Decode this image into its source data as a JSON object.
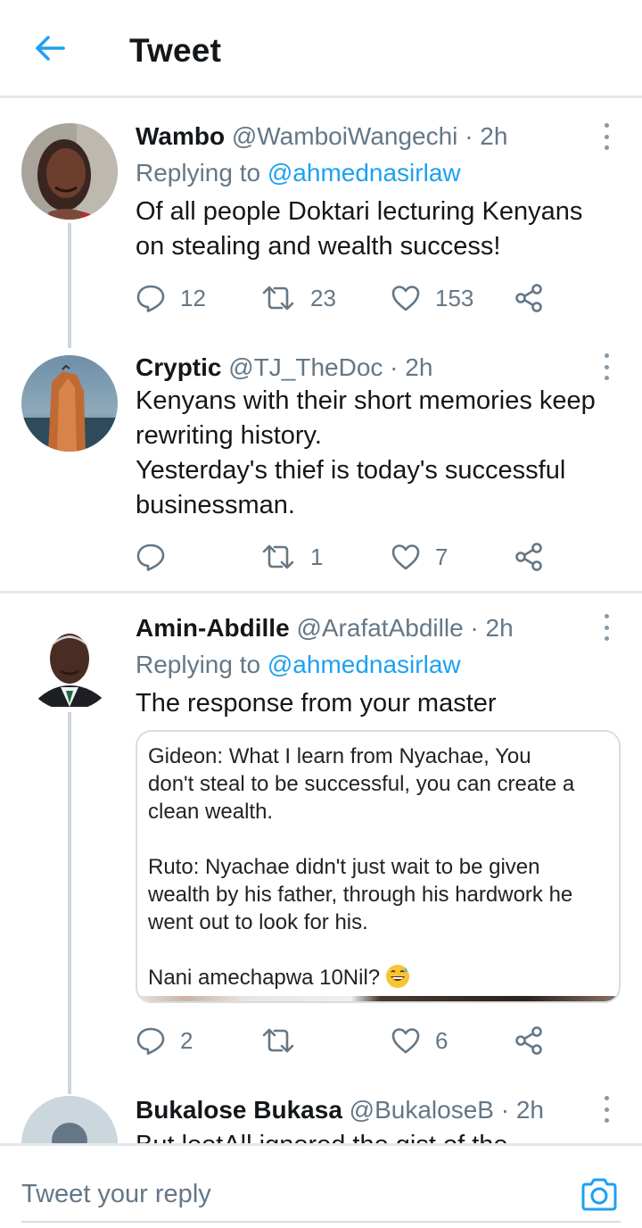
{
  "header": {
    "title": "Tweet",
    "back_icon": "arrow-left-icon"
  },
  "colors": {
    "accent": "#1da1f2",
    "secondary_text": "#657786",
    "divider": "#e3e8ec"
  },
  "tweets": [
    {
      "name": "Wambo",
      "handle": "@WamboiWangechi",
      "time": "· 2h",
      "replying_prefix": "Replying to",
      "replying_to": "@ahmednasirlaw",
      "text_lines": [
        "Of all people Doktari lecturing Kenyans",
        "on stealing and wealth success!"
      ],
      "replies": "12",
      "retweets": "23",
      "likes": "153"
    },
    {
      "name": "Cryptic",
      "handle": "@TJ_TheDoc",
      "time": "· 2h",
      "text_lines": [
        "Kenyans with their short memories keep",
        "rewriting history.",
        "Yesterday's thief is today's successful",
        "businessman."
      ],
      "replies": "",
      "retweets": "1",
      "likes": "7"
    },
    {
      "name": "Amin-Abdille",
      "handle": "@ArafatAbdille",
      "time": "· 2h",
      "replying_prefix": "Replying to",
      "replying_to": "@ahmednasirlaw",
      "text_lines": [
        "The response from your master"
      ],
      "image_text": {
        "para1": [
          "Gideon: What I learn from Nyachae,  You",
          "don't steal to be successful, you can create a",
          "clean wealth."
        ],
        "para2": [
          "Ruto: Nyachae didn't just wait to be given",
          "wealth by his father, through his hardwork he",
          "went out to look for his."
        ],
        "para3": "Nani amechapwa 10Nil?"
      },
      "replies": "2",
      "retweets": "",
      "likes": "6"
    },
    {
      "name": "Bukalose Bukasa",
      "handle": "@BukaloseB",
      "time": "· 2h",
      "text_partial": "But lootAll ignored the gist of the"
    }
  ],
  "reply_bar": {
    "placeholder": "Tweet your reply",
    "camera_icon": "camera-icon"
  }
}
